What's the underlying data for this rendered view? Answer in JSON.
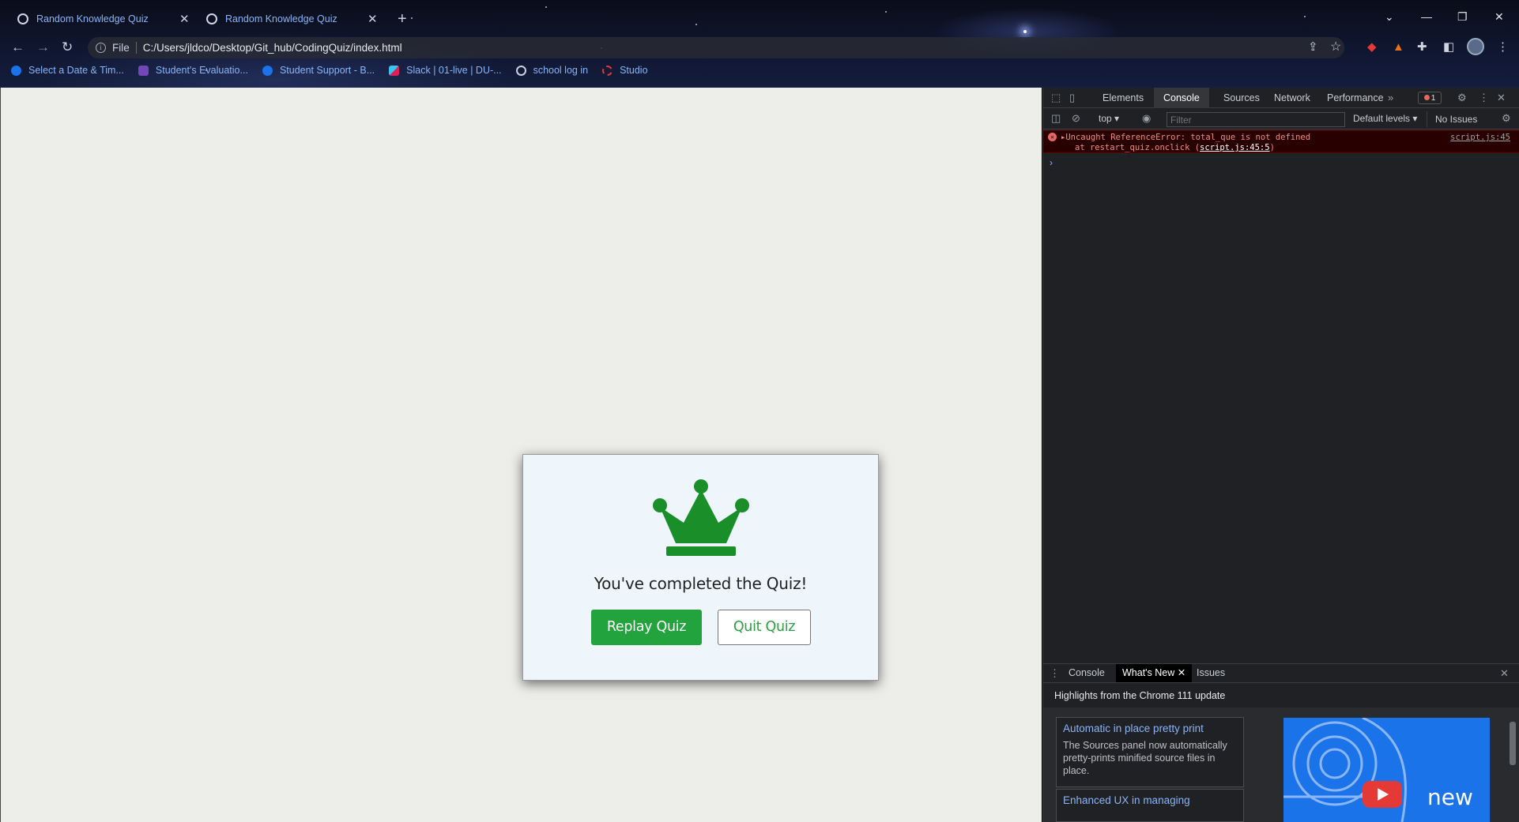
{
  "browser": {
    "tabs": [
      {
        "title": "Random Knowledge Quiz",
        "close": "✕"
      },
      {
        "title": "Random Knowledge Quiz",
        "close": "✕"
      }
    ],
    "new_tab": "+",
    "file_label": "File",
    "url": "C:/Users/jldco/Desktop/Git_hub/CodingQuiz/index.html",
    "bookmarks": [
      {
        "label": "Select a Date & Tim...",
        "icon": "calendly-icon",
        "color": "#1a73e8"
      },
      {
        "label": "Student's Evaluatio...",
        "icon": "forms-icon",
        "color": "#7248b9"
      },
      {
        "label": "Student Support - B...",
        "icon": "support-icon",
        "color": "#1a73e8"
      },
      {
        "label": "Slack | 01-live | DU-...",
        "icon": "slack-icon",
        "color": "#e01e5a"
      },
      {
        "label": "school log in",
        "icon": "globe-icon",
        "color": "#c9d1e0"
      },
      {
        "label": "Studio",
        "icon": "studio-icon",
        "color": "#e53935"
      }
    ]
  },
  "quiz": {
    "message": "You've completed the Quiz!",
    "replay_label": "Replay Quiz",
    "quit_label": "Quit Quiz",
    "crown_color": "#1a8f29"
  },
  "devtools": {
    "tabs": [
      "Elements",
      "Console",
      "Sources",
      "Network",
      "Performance"
    ],
    "active_tab": "Console",
    "error_count": "1",
    "context": "top ▾",
    "filter_placeholder": "Filter",
    "levels": "Default levels ▾",
    "issues": "No Issues",
    "error": {
      "message": "▸Uncaught ReferenceError: total_que is not defined",
      "at_text": "at restart_quiz.onclick (",
      "at_link": "script.js:45:5",
      "at_close": ")",
      "source": "script.js:45"
    },
    "drawer": {
      "tabs": [
        "Console",
        "What's New",
        "Issues"
      ],
      "active_tab": "What's New",
      "heading": "Highlights from the Chrome 111 update",
      "cards": [
        {
          "title": "Automatic in place pretty print",
          "desc": "The Sources panel now automatically pretty-prints minified source files in place."
        },
        {
          "title": "Enhanced UX in managing",
          "desc": ""
        }
      ],
      "video_label": "new"
    }
  }
}
